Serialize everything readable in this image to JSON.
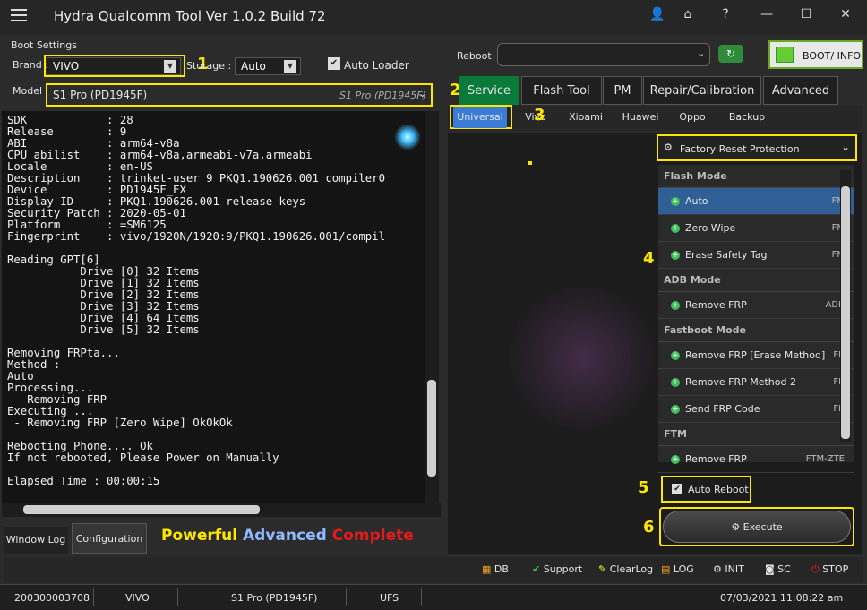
{
  "app": {
    "title": "Hydra Qualcomm  Tool  Ver 1.0.2 Build 72"
  },
  "window": {
    "icons": [
      "user-icon",
      "home-icon",
      "help-icon",
      "minimize-icon",
      "maximize-icon",
      "close-icon"
    ],
    "help": "?",
    "minimize": "—",
    "maximize": "☐",
    "close": "✕"
  },
  "boot": {
    "section_label": "Boot Settings",
    "brand_label": "Brand :",
    "brand_value": "VIVO",
    "storage_label": "Storage :",
    "storage_value": "Auto",
    "autoloader_label": "Auto Loader",
    "model_label": "Model :",
    "model_value": "S1 Pro (PD1945F)",
    "model_hint": "S1 Pro (PD1945F)"
  },
  "annotations": {
    "n1": "1",
    "n2": "2",
    "n3": "3",
    "n4": "4",
    "n5": "5",
    "n6": "6"
  },
  "console": {
    "lines": "SDK            : 28\nRelease        : 9\nABI            : arm64-v8a\nCPU abilist    : arm64-v8a,armeabi-v7a,armeabi\nLocale         : en-US\nDescription    : trinket-user 9 PKQ1.190626.001 compiler0\nDevice         : PD1945F_EX\nDisplay ID     : PKQ1.190626.001 release-keys\nSecurity Patch : 2020-05-01\nPlatform       : =SM6125\nFingerprint    : vivo/1920N/1920:9/PKQ1.190626.001/compil\n\nReading GPT[6]\n           Drive [0] 32 Items\n           Drive [1] 32 Items\n           Drive [2] 32 Items\n           Drive [3] 32 Items\n           Drive [4] 64 Items\n           Drive [5] 32 Items\n\nRemoving FRPta...\nMethod :\nAuto\nProcessing...\n - Removing FRP\nExecuting ...\n - Removing FRP [Zero Wipe] OkOkOk\n\nRebooting Phone.... Ok\nIf not rebooted, Please Power on Manually\n\nElapsed Time : 00:00:15"
  },
  "left_tabs": [
    "Window Log",
    "Configuration"
  ],
  "slogan": {
    "a": "Powerful",
    "b": "Advanced",
    "c": "Complete"
  },
  "reboot": {
    "label": "Reboot",
    "value": "",
    "boot_info": "BOOT/ INFO"
  },
  "main_tabs": [
    "Service",
    "Flash Tool",
    "PM",
    "Repair/Calibration",
    "Advanced"
  ],
  "sub_tabs": [
    "Universal",
    "Vivo",
    "Xioami",
    "Huawei",
    "Oppo",
    "Backup"
  ],
  "frp_dropdown": "Factory Reset Protection",
  "list": {
    "flash_mode": "Flash Mode",
    "fm_items": [
      {
        "label": "Auto",
        "short": "FM"
      },
      {
        "label": "Zero Wipe",
        "short": "FM"
      },
      {
        "label": "Erase Safety Tag",
        "short": "FM"
      }
    ],
    "adb_mode": "ADB Mode",
    "adb_items": [
      {
        "label": "Remove FRP",
        "short": "ADB"
      }
    ],
    "fastboot_mode": "Fastboot Mode",
    "fb_items": [
      {
        "label": "Remove FRP [Erase Method]",
        "short": "FB"
      },
      {
        "label": "Remove FRP Method 2",
        "short": "FB"
      },
      {
        "label": "Send FRP Code",
        "short": "FB"
      }
    ],
    "ftm": "FTM",
    "ftm_items": [
      {
        "label": "Remove FRP",
        "short": "FTM-ZTE"
      }
    ]
  },
  "auto_reboot": "Auto Reboot",
  "execute": "Execute",
  "toolbar": [
    "DB",
    "Support",
    "ClearLog",
    "LOG",
    "INIT",
    "SC",
    "STOP"
  ],
  "status": {
    "serial": "200300003708",
    "brand": "VIVO",
    "model": "S1 Pro (PD1945F)",
    "storage": "UFS",
    "datetime": "07/03/2021 11:08:22 am"
  },
  "colors": {
    "accent_green": "#0a7a3a",
    "yellow": "#ffe600",
    "select_blue": "#2f5f95"
  }
}
